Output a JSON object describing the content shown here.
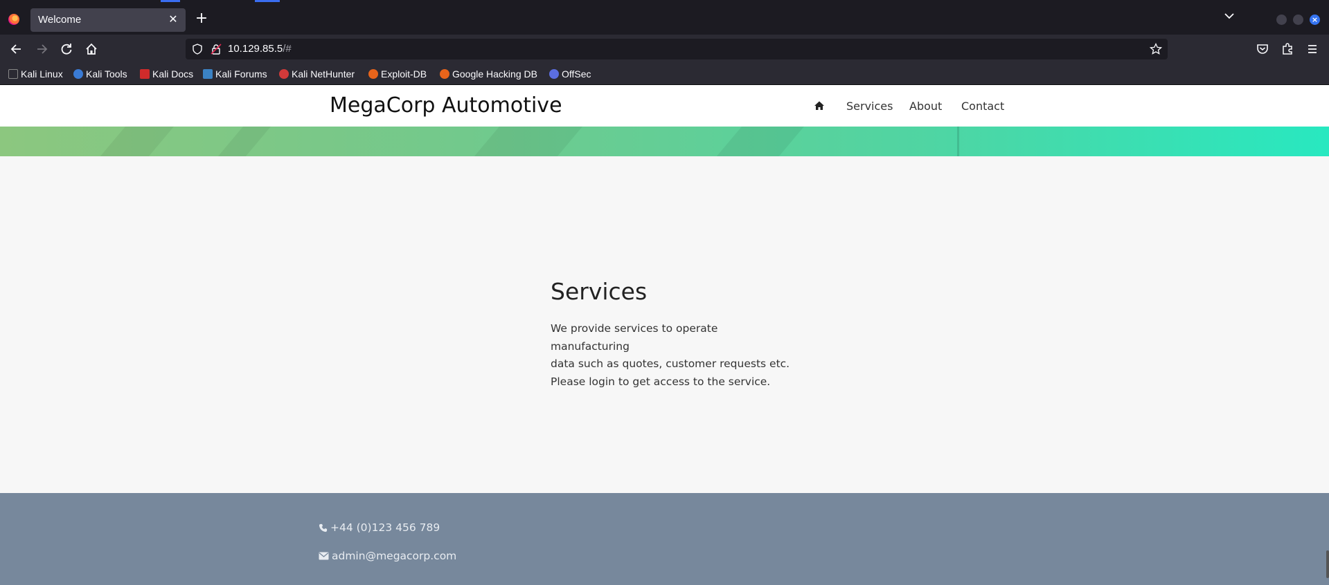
{
  "browser": {
    "tab_title": "Welcome",
    "url_host": "10.129.85.5",
    "url_path": "/#",
    "bookmarks": [
      {
        "label": "Kali Linux",
        "icon": "kali-dragon-icon",
        "color": "#222222"
      },
      {
        "label": "Kali Tools",
        "icon": "kali-tools-icon",
        "color": "#3a7bd5"
      },
      {
        "label": "Kali Docs",
        "icon": "kali-docs-icon",
        "color": "#d02b2b"
      },
      {
        "label": "Kali Forums",
        "icon": "kali-forums-icon",
        "color": "#3b82c4"
      },
      {
        "label": "Kali NetHunter",
        "icon": "nethunter-icon",
        "color": "#d23a3a"
      },
      {
        "label": "Exploit-DB",
        "icon": "exploit-db-icon",
        "color": "#e8641b"
      },
      {
        "label": "Google Hacking DB",
        "icon": "ghdb-icon",
        "color": "#e8641b"
      },
      {
        "label": "OffSec",
        "icon": "offsec-icon",
        "color": "#5b6ee1"
      }
    ]
  },
  "site": {
    "brand": "MegaCorp Automotive",
    "nav": {
      "home_icon": "home-icon",
      "services": "Services",
      "about": "About",
      "contact": "Contact"
    },
    "services": {
      "heading": "Services",
      "lines": [
        "We provide services to operate manufacturing",
        "data such as quotes, customer requests etc.",
        "Please login to get access to the service."
      ]
    },
    "footer": {
      "phone": "+44 (0)123 456 789",
      "email": "admin@megacorp.com"
    }
  },
  "colors": {
    "hero_start": "#8cc77f",
    "hero_end": "#28e8c0",
    "footer_bg": "#77889c",
    "accent_blue": "#3574f0"
  }
}
